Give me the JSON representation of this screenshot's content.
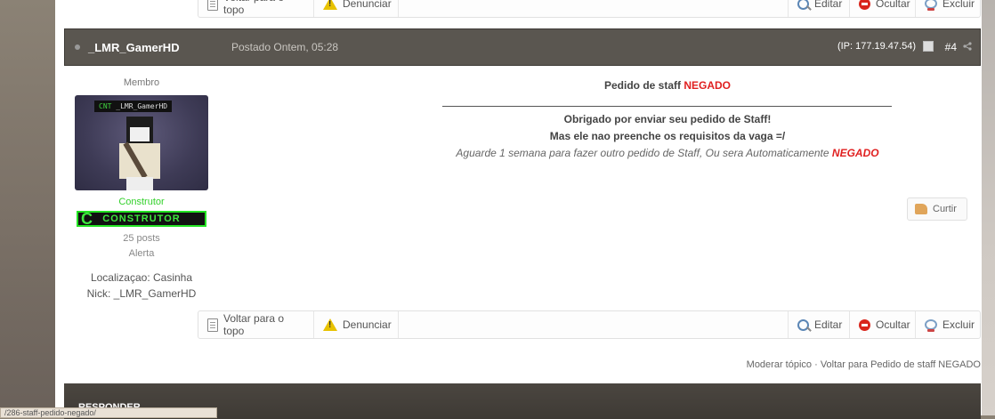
{
  "top_bar": {
    "back_to_top": "Voltar para o topo",
    "report": "Denunciar",
    "edit": "Editar",
    "hide": "Ocultar",
    "delete": "Excluir"
  },
  "post": {
    "author": "_LMR_GamerHD",
    "posted": "Postado Ontem, 05:28",
    "ip": "(IP: 177.19.47.54)",
    "number": "#4"
  },
  "user": {
    "role": "Membro",
    "avatar_tag_prefix": "CNT",
    "avatar_tag_name": "_LMR_GamerHD",
    "rank_title": "Construtor",
    "rank_badge_letter": "C",
    "rank_badge_text": "CONSTRUTOR",
    "posts": "25 posts",
    "alert": "Alerta",
    "location": "Localizaçao: Casinha",
    "nick": "Nick: _LMR_GamerHD"
  },
  "body": {
    "title_prefix": "Pedido de staff ",
    "title_status": "NEGADO",
    "line1": "Obrigado por enviar seu pedido de Staff!",
    "line2": "Mas ele nao preenche os requisitos da vaga =/",
    "line3_prefix": "Aguarde 1 semana para fazer outro pedido de Staff, Ou sera Automaticamente ",
    "line3_status": "NEGADO"
  },
  "like": {
    "label": "Curtir"
  },
  "bottom_bar": {
    "back_to_top": "Voltar para o topo",
    "report": "Denunciar",
    "edit": "Editar",
    "hide": "Ocultar",
    "delete": "Excluir"
  },
  "footer": {
    "moderate": "Moderar tópico",
    "separator": " · ",
    "back_link": "Voltar para Pedido de staff NEGADO",
    "reply": "RESPONDER",
    "status_url": "/286-staff-pedido-negado/"
  },
  "colors": {
    "header_bg": "#5a5650",
    "accent_red": "#e02020",
    "rank_green": "#34d12c"
  }
}
